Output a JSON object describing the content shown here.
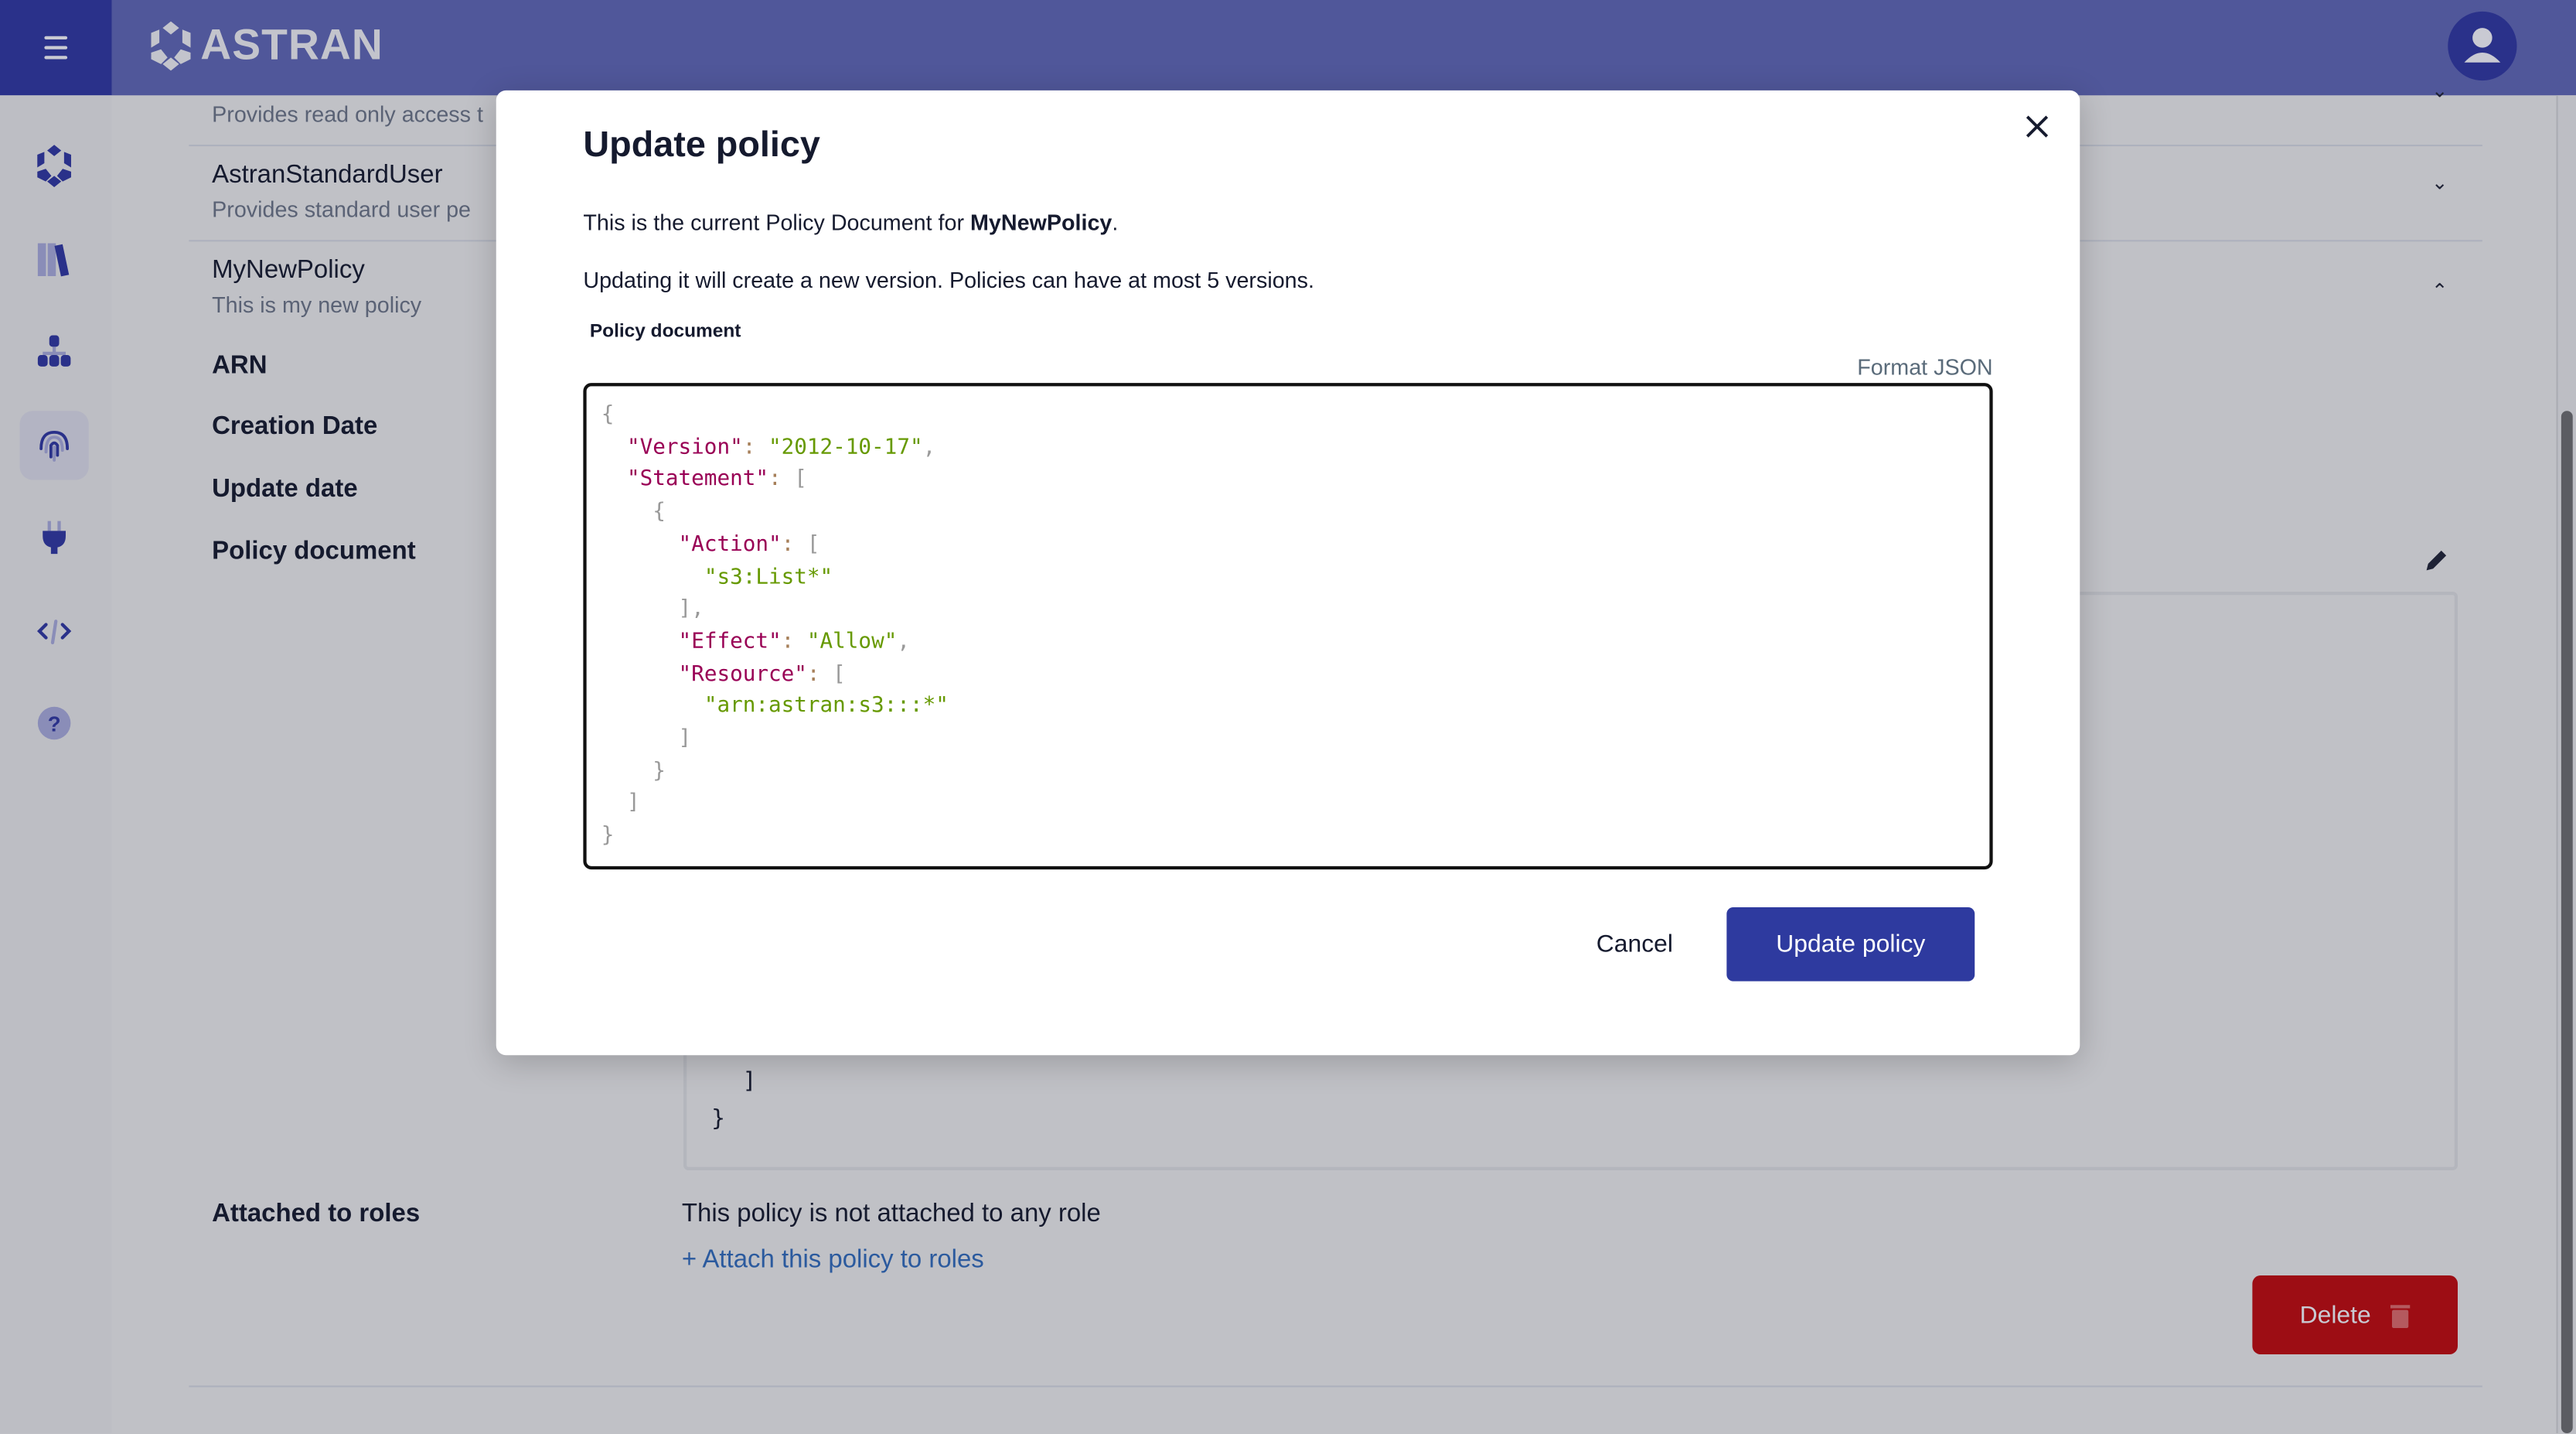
{
  "header": {
    "brand": "ASTRAN",
    "menu_icon": "hamburger-icon",
    "avatar_icon": "user-icon",
    "colors": {
      "header": "#50579a",
      "accent": "#2a318a"
    }
  },
  "sidebar": {
    "items": [
      {
        "icon": "astran-logo-icon"
      },
      {
        "icon": "library-icon"
      },
      {
        "icon": "hierarchy-icon"
      },
      {
        "icon": "fingerprint-icon",
        "selected": true
      },
      {
        "icon": "plug-icon"
      },
      {
        "icon": "code-icon"
      },
      {
        "icon": "help-icon"
      }
    ]
  },
  "policies": [
    {
      "desc": "Provides read only access t"
    },
    {
      "name": "AstranStandardUser",
      "desc": "Provides standard user pe"
    },
    {
      "name": "MyNewPolicy",
      "desc": "This is my new policy"
    }
  ],
  "details": {
    "arn": "ARN",
    "creation": "Creation Date",
    "update": "Update date",
    "document": "Policy document",
    "attached_label": "Attached to roles",
    "attached_value": "This policy is not attached to any role",
    "attach_link": "+ Attach this policy to roles",
    "json_tail": [
      "]",
      "}"
    ],
    "delete_label": "Delete",
    "delete_color": "#9d0d14"
  },
  "modal": {
    "title": "Update policy",
    "line1_prefix": "This is the current Policy Document for ",
    "policy_name": "MyNewPolicy",
    "line1_suffix": ".",
    "line2": "Updating it will create a new version. Policies can have at most 5 versions.",
    "field_label": "Policy document",
    "format_json": "Format JSON",
    "code": [
      [
        [
          "p",
          "{"
        ]
      ],
      [
        [
          "p",
          "  "
        ],
        [
          "k",
          "\"Version\""
        ],
        [
          "c",
          ": "
        ],
        [
          "s",
          "\"2012-10-17\""
        ],
        [
          "p",
          ","
        ]
      ],
      [
        [
          "p",
          "  "
        ],
        [
          "k",
          "\"Statement\""
        ],
        [
          "c",
          ": "
        ],
        [
          "p",
          "["
        ]
      ],
      [
        [
          "p",
          "    {"
        ]
      ],
      [
        [
          "p",
          "      "
        ],
        [
          "k",
          "\"Action\""
        ],
        [
          "c",
          ": "
        ],
        [
          "p",
          "["
        ]
      ],
      [
        [
          "p",
          "        "
        ],
        [
          "s",
          "\"s3:List*\""
        ]
      ],
      [
        [
          "p",
          "      ],"
        ]
      ],
      [
        [
          "p",
          "      "
        ],
        [
          "k",
          "\"Effect\""
        ],
        [
          "c",
          ": "
        ],
        [
          "s",
          "\"Allow\""
        ],
        [
          "p",
          ","
        ]
      ],
      [
        [
          "p",
          "      "
        ],
        [
          "k",
          "\"Resource\""
        ],
        [
          "c",
          ": "
        ],
        [
          "p",
          "["
        ]
      ],
      [
        [
          "p",
          "        "
        ],
        [
          "s",
          "\"arn:astran:s3:::*\""
        ]
      ],
      [
        [
          "p",
          "      ]"
        ]
      ],
      [
        [
          "p",
          "    }"
        ]
      ],
      [
        [
          "p",
          "  ]"
        ]
      ],
      [
        [
          "p",
          "}"
        ]
      ]
    ],
    "cancel_label": "Cancel",
    "update_label": "Update policy",
    "primary_color": "#2e3a9f"
  }
}
